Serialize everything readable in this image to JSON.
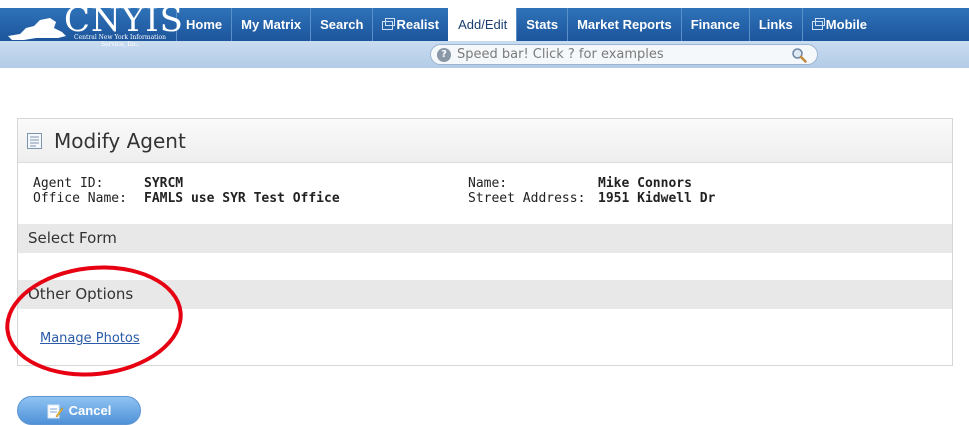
{
  "logo": {
    "text": "CNYIS",
    "subtitle": "Central New York Information Service, Inc."
  },
  "nav": {
    "tabs": [
      {
        "label": "Home",
        "external": false,
        "active": false
      },
      {
        "label": "My Matrix",
        "external": false,
        "active": false
      },
      {
        "label": "Search",
        "external": false,
        "active": false
      },
      {
        "label": "Realist",
        "external": true,
        "active": false
      },
      {
        "label": "Add/Edit",
        "external": false,
        "active": true
      },
      {
        "label": "Stats",
        "external": false,
        "active": false
      },
      {
        "label": "Market Reports",
        "external": false,
        "active": false
      },
      {
        "label": "Finance",
        "external": false,
        "active": false
      },
      {
        "label": "Links",
        "external": false,
        "active": false
      },
      {
        "label": "Mobile",
        "external": true,
        "active": false
      }
    ]
  },
  "speedbar": {
    "placeholder": "Speed bar! Click ? for examples",
    "help_icon": "question-icon",
    "search_icon": "magnifier-icon"
  },
  "panel": {
    "title": "Modify Agent",
    "icon": "document-icon",
    "agent_id_label": "Agent ID:",
    "agent_id_value": "SYRCM",
    "office_name_label": "Office Name:",
    "office_name_value": "FAMLS use SYR Test Office",
    "name_label": "Name:",
    "name_value": "Mike Connors",
    "street_label": "Street Address:",
    "street_value": "1951 Kidwell Dr",
    "select_form_title": "Select Form",
    "other_options_title": "Other Options",
    "manage_photos_link": "Manage Photos"
  },
  "actions": {
    "cancel_label": "Cancel"
  },
  "colors": {
    "nav_blue": "#2f72b8",
    "subbar_blue": "#c9dcf0",
    "link_blue": "#2a5aa8",
    "annotation_red": "#e60012"
  }
}
